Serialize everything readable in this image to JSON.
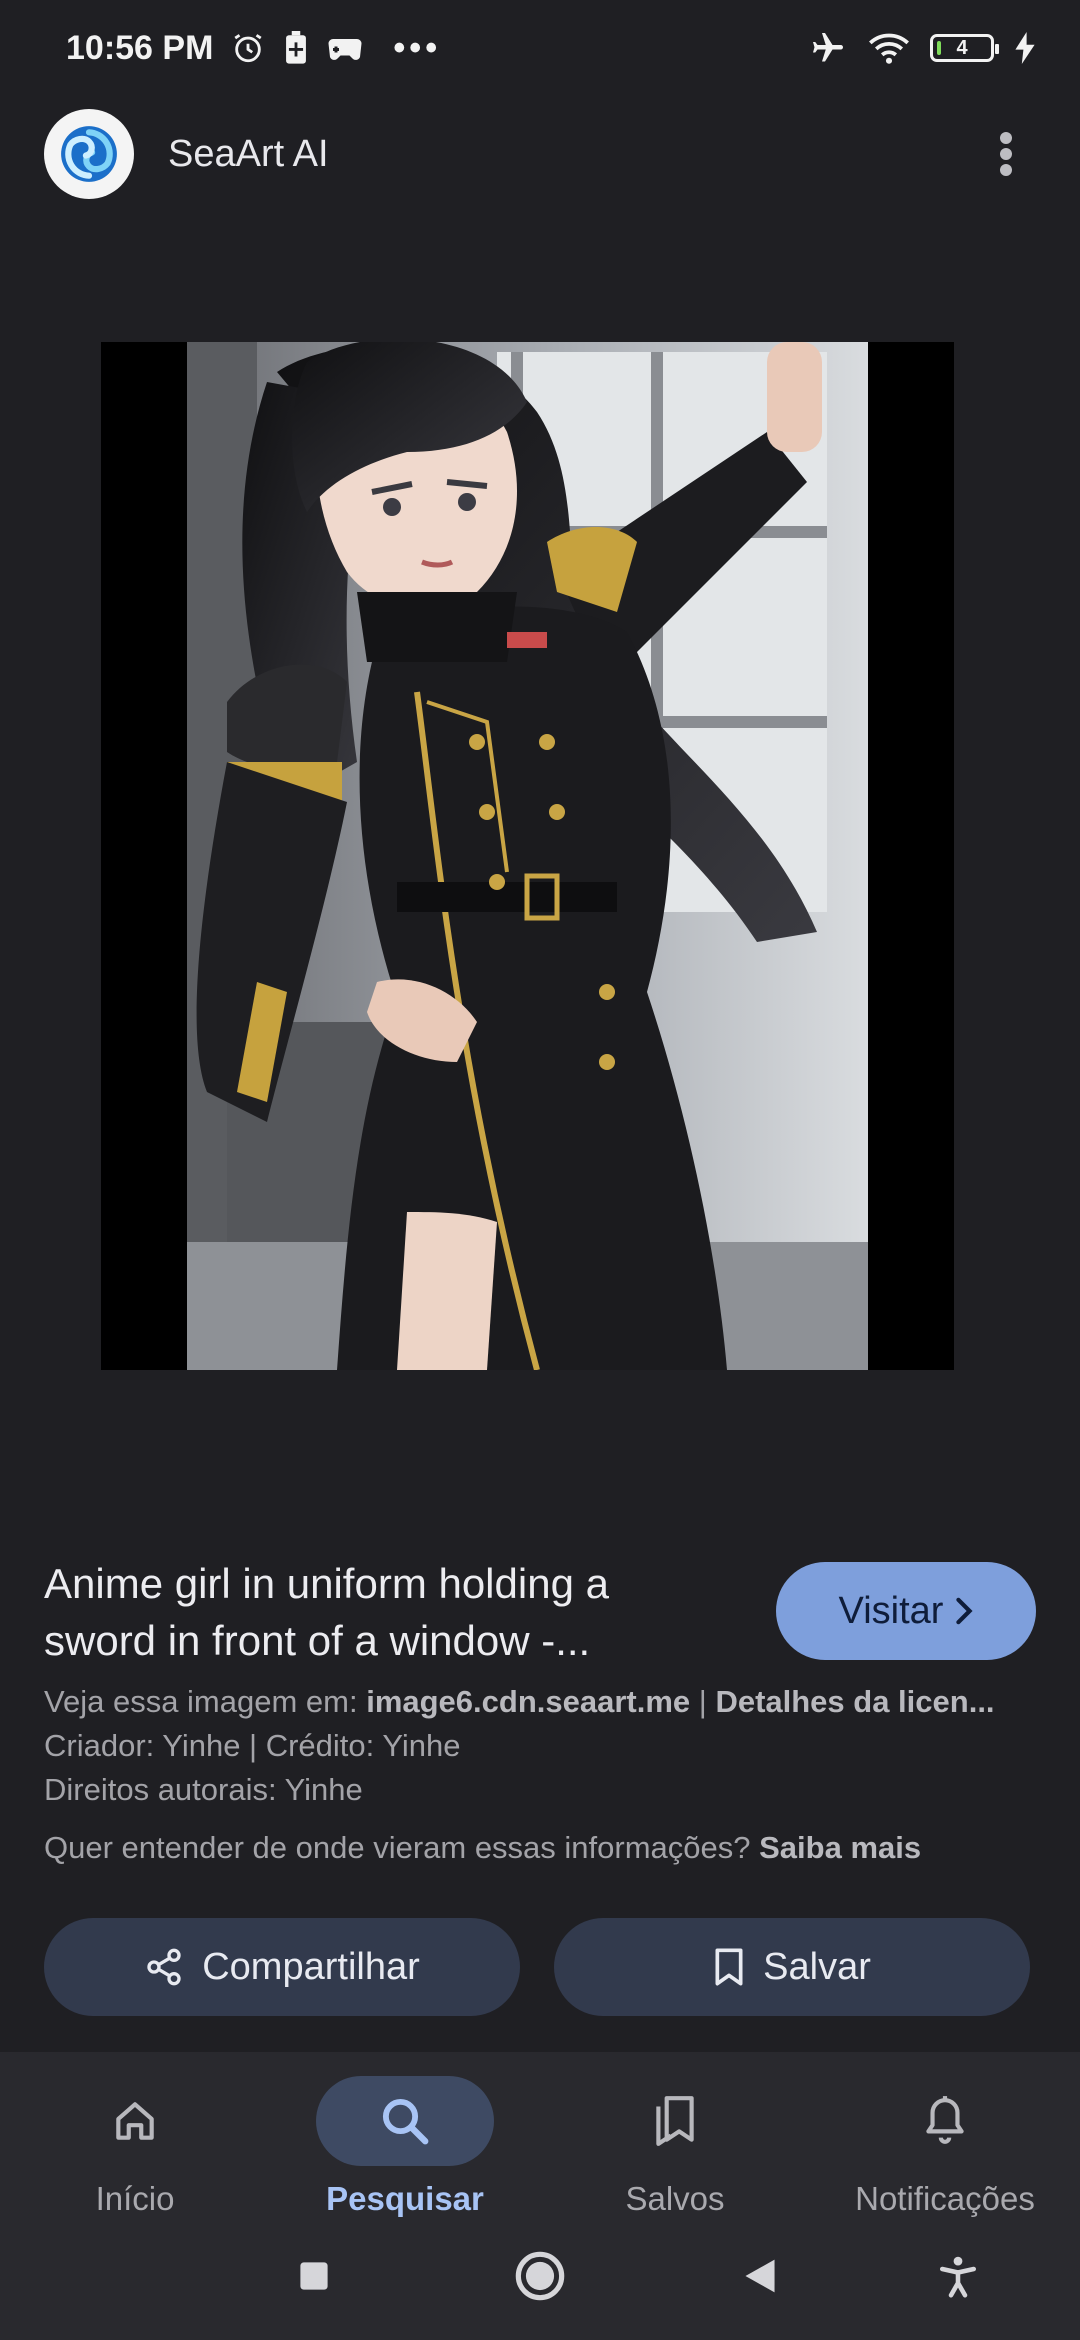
{
  "status_bar": {
    "time": "10:56 PM",
    "more": "•••",
    "battery_level": "4"
  },
  "header": {
    "app_name": "SeaArt AI"
  },
  "result": {
    "title": "Anime girl in uniform holding a sword in front of a window -...",
    "visit_label": "Visitar",
    "source_prefix": "Veja essa imagem em: ",
    "source_domain": "image6.cdn.seaart.me",
    "source_sep": " | ",
    "license_link": "Detalhes da licen...",
    "creator": "Criador: Yinhe | Crédito: Yinhe",
    "rights": "Direitos autorais: Yinhe",
    "learn_prefix": "Quer entender de onde vieram essas informações? ",
    "learn_link": "Saiba mais"
  },
  "actions": {
    "share_label": "Compartilhar",
    "save_label": "Salvar"
  },
  "bottom_nav": {
    "items": [
      {
        "label": "Início",
        "icon": "home-icon"
      },
      {
        "label": "Pesquisar",
        "icon": "search-icon",
        "active": true
      },
      {
        "label": "Salvos",
        "icon": "bookmarks-icon"
      },
      {
        "label": "Notificações",
        "icon": "bell-icon"
      }
    ]
  },
  "colors": {
    "background": "#1f1f23",
    "accent": "#7e9fdc",
    "active_nav": "#a8c4f5",
    "button_bg": "#323a4d"
  }
}
